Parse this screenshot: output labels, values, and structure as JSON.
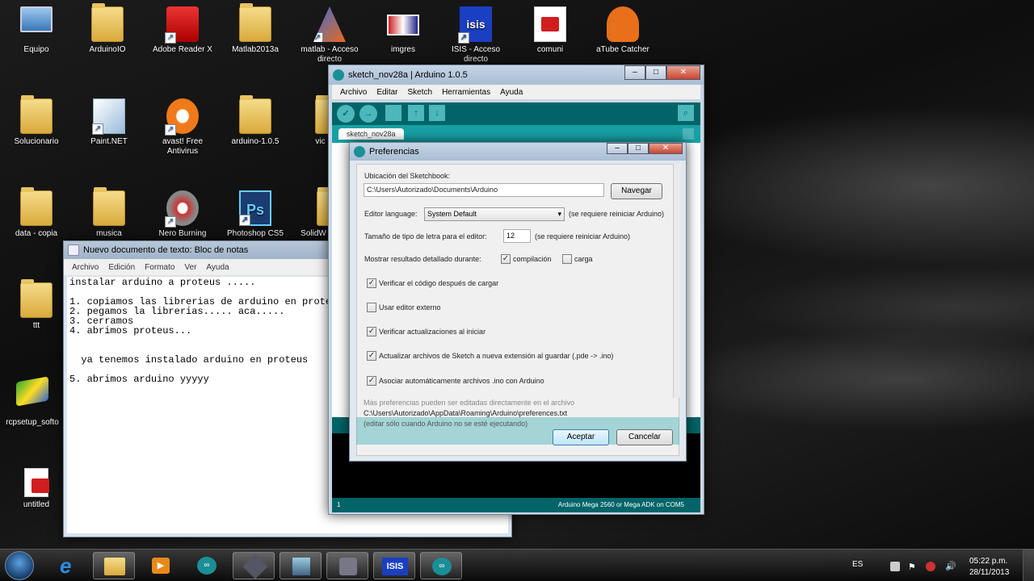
{
  "desktop_icons": [
    {
      "name": "equipo",
      "label": "Equipo"
    },
    {
      "name": "arduinoio",
      "label": "ArduinoIO"
    },
    {
      "name": "adobe-reader",
      "label": "Adobe Reader X"
    },
    {
      "name": "matlab2013a",
      "label": "Matlab2013a"
    },
    {
      "name": "matlab-acceso",
      "label": "matlab - Acceso directo"
    },
    {
      "name": "imgres",
      "label": "imgres"
    },
    {
      "name": "isis-acceso",
      "label": "ISIS - Acceso directo"
    },
    {
      "name": "comuni",
      "label": "comuni"
    },
    {
      "name": "atube",
      "label": "aTube Catcher"
    },
    {
      "name": "solucionario",
      "label": "Solucionario"
    },
    {
      "name": "paintnet",
      "label": "Paint.NET"
    },
    {
      "name": "avast",
      "label": "avast! Free Antivirus"
    },
    {
      "name": "arduino105",
      "label": "arduino-1.0.5"
    },
    {
      "name": "vic",
      "label": "vic"
    },
    {
      "name": "data-copia",
      "label": "data - copia"
    },
    {
      "name": "musica",
      "label": "musica"
    },
    {
      "name": "nero",
      "label": "Nero Burning"
    },
    {
      "name": "photoshop",
      "label": "Photoshop CS5"
    },
    {
      "name": "solidw",
      "label": "SolidW"
    },
    {
      "name": "ttt",
      "label": "ttt"
    },
    {
      "name": "rcpsetup",
      "label": "rcpsetup_softo"
    },
    {
      "name": "untitled",
      "label": "untitled"
    }
  ],
  "notepad": {
    "title": "Nuevo documento de texto: Bloc de notas",
    "menu": [
      "Archivo",
      "Edición",
      "Formato",
      "Ver",
      "Ayuda"
    ],
    "content": "instalar arduino a proteus .....\n\n1. copiamos las librerias de arduino en proteus\n2. pegamos la librerias..... aca.....\n3. cerramos\n4. abrimos proteus...\n\n\n  ya tenemos instalado arduino en proteus\n\n5. abrimos arduino yyyyy"
  },
  "arduino": {
    "title": "sketch_nov28a | Arduino 1.0.5",
    "menu": [
      "Archivo",
      "Editar",
      "Sketch",
      "Herramientas",
      "Ayuda"
    ],
    "tab": "sketch_nov28a",
    "status_line": "1",
    "status_board": "Arduino Mega 2560 or Mega ADK on COM5"
  },
  "preferences": {
    "title": "Preferencias",
    "sketchbook_label": "Ubicación del Sketchbook:",
    "sketchbook_path": "C:\\Users\\Autorizado\\Documents\\Arduino",
    "browse": "Navegar",
    "editor_language_label": "Editor language:",
    "editor_language_value": "System Default",
    "restart_note": "(se requiere reiniciar Arduino)",
    "font_size_label": "Tamaño de tipo de letra para el editor:",
    "font_size_value": "12",
    "verbose_label": "Mostrar resultado detallado durante:",
    "compile_label": "compilación",
    "upload_label": "carga",
    "checks": [
      {
        "label": "Verificar el código después de cargar",
        "checked": true
      },
      {
        "label": "Usar editor externo",
        "checked": false
      },
      {
        "label": "Verificar actualizaciones al iniciar",
        "checked": true
      },
      {
        "label": "Actualizar archivos de Sketch a nueva extensión al guardar (.pde -> .ino)",
        "checked": true
      },
      {
        "label": "Asociar automáticamente archivos .ino con Arduino",
        "checked": true
      }
    ],
    "more_prefs": "Más preferencias pueden ser editadas directamente en el archivo",
    "prefs_path": "C:\\Users\\Autorizado\\AppData\\Roaming\\Arduino\\preferences.txt",
    "edit_note": "(editar sólo cuando Arduino no se esté ejecutando)",
    "ok": "Aceptar",
    "cancel": "Cancelar"
  },
  "taskbar": {
    "language": "ES",
    "time": "05:22 p.m.",
    "date": "28/11/2013",
    "isis_label": "ISIS"
  }
}
